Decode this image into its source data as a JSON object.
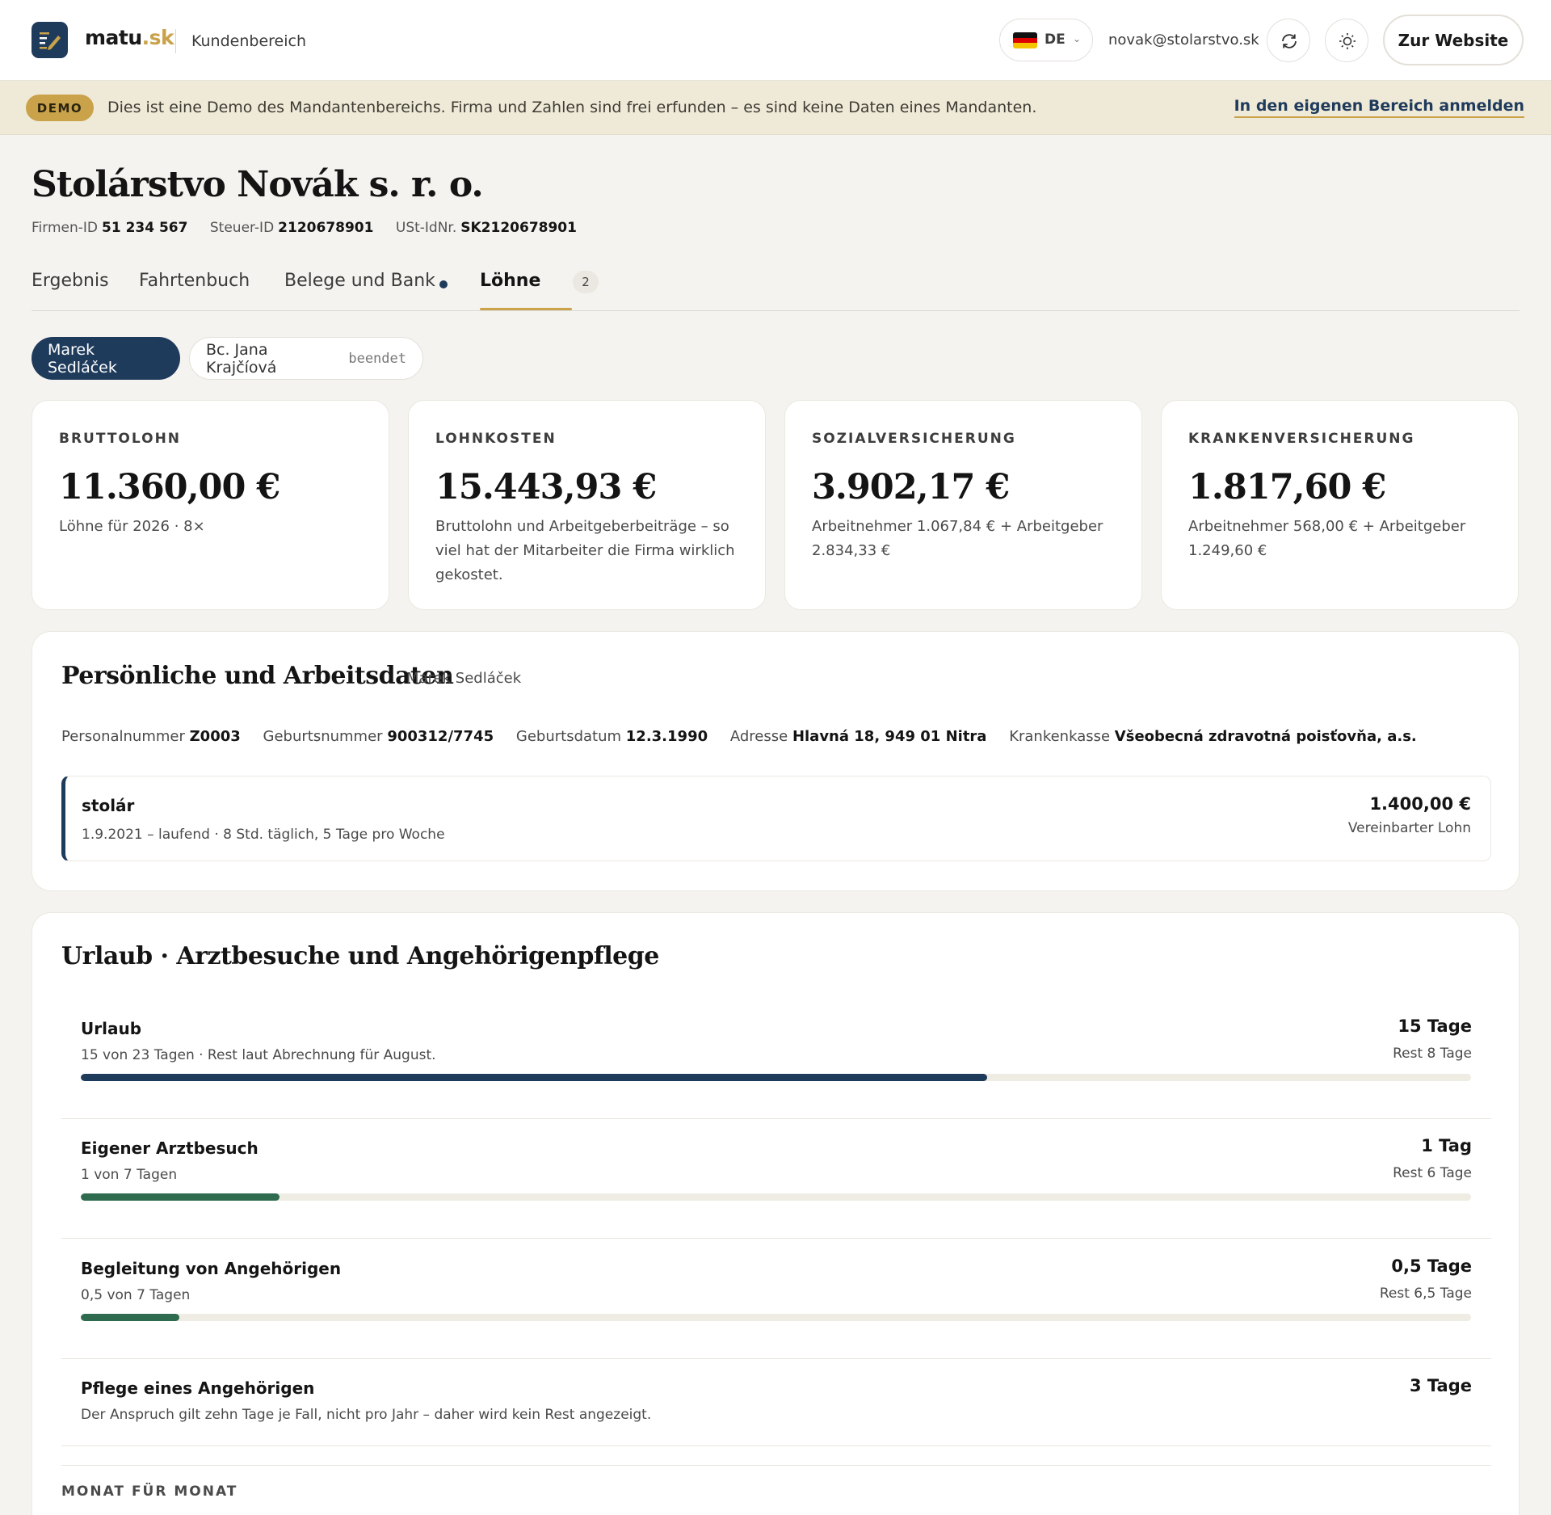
{
  "header": {
    "brand_main": "matu",
    "brand_tld": ".sk",
    "section": "Kundenbereich",
    "language": "DE",
    "user_email": "novak@stolarstvo.sk",
    "website_button": "Zur Website",
    "brand_color": "#1f3b5c",
    "accent_color": "#c9a24a"
  },
  "demo_banner": {
    "badge": "DEMO",
    "text": "Dies ist eine Demo des Mandantenbereichs. Firma und Zahlen sind frei erfunden – es sind keine Daten eines Mandanten.",
    "login_link": "In den eigenen Bereich anmelden"
  },
  "company": {
    "name": "Stolárstvo Novák s. r. o.",
    "firm_id_label": "Firmen-ID",
    "firm_id": "51 234 567",
    "tax_id_label": "Steuer-ID",
    "tax_id": "2120678901",
    "vat_id_label": "USt-IdNr.",
    "vat_id": "SK2120678901"
  },
  "tabs": [
    {
      "label": "Ergebnis"
    },
    {
      "label": "Fahrtenbuch"
    },
    {
      "label": "Belege und Bank"
    },
    {
      "label": "Löhne",
      "count": "2"
    }
  ],
  "employees": [
    {
      "name": "Marek Sedláček"
    },
    {
      "name": "Bc. Jana Krajčíová",
      "status": "beendet"
    }
  ],
  "stats": [
    {
      "label": "BRUTTOLOHN",
      "value": "11.360,00 €",
      "sub": "Löhne für 2026 · 8×"
    },
    {
      "label": "LOHNKOSTEN",
      "value": "15.443,93 €",
      "sub": "Bruttolohn und Arbeitgeberbeiträge – so viel hat der Mitarbeiter die Firma wirklich gekostet."
    },
    {
      "label": "SOZIALVERSICHERUNG",
      "value": "3.902,17 €",
      "sub": "Arbeitnehmer 1.067,84 € + Arbeitgeber 2.834,33 €"
    },
    {
      "label": "KRANKENVERSICHERUNG",
      "value": "1.817,60 €",
      "sub": "Arbeitnehmer 568,00 € + Arbeitgeber 1.249,60 €"
    }
  ],
  "personal": {
    "title": "Persönliche und Arbeitsdaten",
    "subtitle": "Marek Sedláček",
    "fields": [
      {
        "label": "Personalnummer",
        "value": "Z0003"
      },
      {
        "label": "Geburtsnummer",
        "value": "900312/7745"
      },
      {
        "label": "Geburtsdatum",
        "value": "12.3.1990"
      },
      {
        "label": "Adresse",
        "value": "Hlavná 18, 949 01 Nitra"
      },
      {
        "label": "Krankenkasse",
        "value": "Všeobecná zdravotná poisťovňa, a.s."
      }
    ],
    "job": {
      "title": "stolár",
      "details": "1.9.2021 – laufend · 8 Std. täglich, 5 Tage pro Woche",
      "amount": "1.400,00 €",
      "amount_label": "Vereinbarter Lohn"
    }
  },
  "leave": {
    "title": "Urlaub · Arztbesuche und Angehörigenpflege",
    "items": [
      {
        "name": "Urlaub",
        "sub": "15 von 23 Tagen · Rest laut Abrechnung für August.",
        "amount": "15 Tage",
        "rest": "Rest 8 Tage",
        "fraction": 0.652,
        "color": "#1f3b5c"
      },
      {
        "name": "Eigener Arztbesuch",
        "sub": "1 von 7 Tagen",
        "amount": "1 Tag",
        "rest": "Rest 6 Tage",
        "fraction": 0.143,
        "color": "#2e6b4f"
      },
      {
        "name": "Begleitung von Angehörigen",
        "sub": "0,5 von 7 Tagen",
        "amount": "0,5 Tage",
        "rest": "Rest 6,5 Tage",
        "fraction": 0.071,
        "color": "#2e6b4f"
      },
      {
        "name": "Pflege eines Angehörigen",
        "sub": "Der Anspruch gilt zehn Tage je Fall, nicht pro Jahr – daher wird kein Rest angezeigt.",
        "amount": "3 Tage"
      }
    ],
    "monthly_label": "MONAT FÜR MONAT"
  }
}
